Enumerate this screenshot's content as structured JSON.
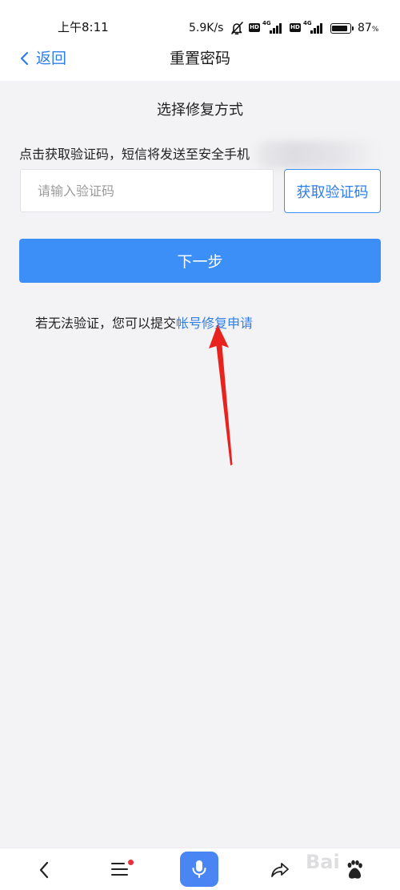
{
  "status_bar": {
    "time": "上午8:11",
    "net_speed": "5.9K/s",
    "mute_icon": "mute-icon",
    "sim1": {
      "hd": "HD",
      "network": "4G"
    },
    "sim2": {
      "hd": "HD",
      "network": "4G"
    },
    "battery_icon": "battery-icon",
    "battery_level": 0.87,
    "battery_percent": "87",
    "battery_unit": "%"
  },
  "header": {
    "back_icon": "chevron-left-icon",
    "back_label": "返回",
    "title": "重置密码"
  },
  "main": {
    "section_title": "选择修复方式",
    "sms_hint": "点击获取验证码，短信将发送至安全手机",
    "code_input": {
      "value": "",
      "placeholder": "请输入验证码"
    },
    "get_code_label": "获取验证码",
    "next_label": "下一步",
    "fallback_text": "若无法验证，您可以提交",
    "fallback_link": "帐号修复申请"
  },
  "annotation": {
    "icon": "red-arrow-icon"
  },
  "bottom_bar": {
    "items": [
      {
        "icon": "back-icon"
      },
      {
        "icon": "menu-icon",
        "notification_dot": true
      },
      {
        "icon": "microphone-icon"
      },
      {
        "icon": "share-icon"
      },
      {
        "icon": "baidu-paw-icon"
      }
    ]
  },
  "watermark": "Bai",
  "colors": {
    "accent": "#2f7ee8",
    "primary": "#3d8ff8",
    "page_background": "#f3f3f5",
    "annotation_arrow": "#e8231f",
    "notification_dot": "#e8313a",
    "mic_button": "#4a85f4"
  }
}
